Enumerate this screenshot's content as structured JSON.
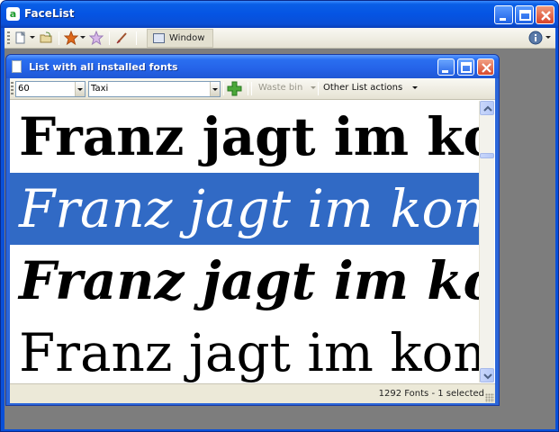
{
  "app": {
    "title": "FaceList",
    "icon": "app-logo-icon"
  },
  "app_toolbar": {
    "window_label": "Window",
    "icons": [
      "new-document-icon",
      "open-folder-icon",
      "star-icon",
      "star-outline-icon",
      "paint-brush-icon",
      "help-icon"
    ]
  },
  "child_window": {
    "title": "List with all installed fonts"
  },
  "list_toolbar": {
    "size_value": "60",
    "font_value": "Taxi",
    "waste_bin_label": "Waste bin",
    "other_actions_label": "Other List actions"
  },
  "font_list": {
    "rows": [
      {
        "sample": "Franz jagt im kom",
        "style": "bold",
        "selected": false
      },
      {
        "sample": "Franz jagt im komp",
        "style": "italic",
        "selected": true
      },
      {
        "sample": "Franz jagt im kon",
        "style": "bold-italic",
        "selected": false
      },
      {
        "sample": "Franz jagt im kompl",
        "style": "regular",
        "selected": false
      }
    ]
  },
  "status": {
    "text": "1292 Fonts - 1 selected"
  },
  "colors": {
    "selection": "#316ac5",
    "titlebar": "#0554e3",
    "background": "#7d7d7d"
  }
}
